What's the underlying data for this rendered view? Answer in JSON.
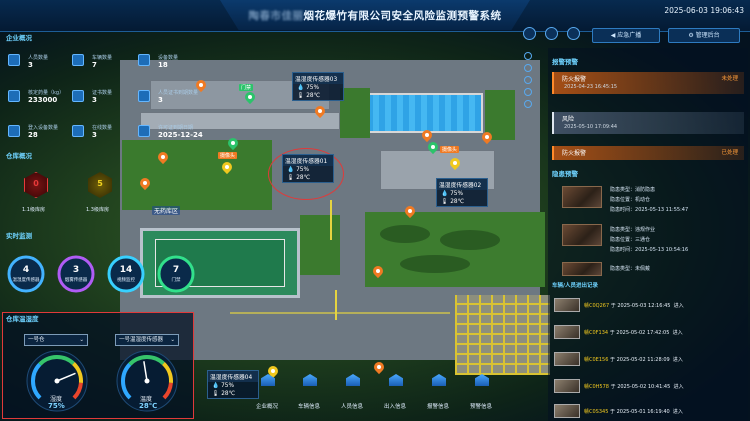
{
  "header": {
    "title_blurred": "陶春市佳丽",
    "title_main": "烟花爆竹有限公司安全风险监测预警系统",
    "datetime": "2025-06-03 19:06:43",
    "btn_broadcast": "应急广播",
    "btn_manage": "管理后台"
  },
  "enterprise": {
    "section_title": "企业概况",
    "stats": [
      {
        "label": "人员数量",
        "value": "3"
      },
      {
        "label": "车辆数量",
        "value": "7"
      },
      {
        "label": "设备数量",
        "value": "18"
      },
      {
        "label": "核定药量（kg）",
        "value": "233000"
      },
      {
        "label": "证书数量",
        "value": "3"
      },
      {
        "label": "人员证书到期数量",
        "value": "3"
      },
      {
        "label": "登入设备数量",
        "value": "28"
      },
      {
        "label": "在线数量",
        "value": "3"
      },
      {
        "label": "许可证到期日期",
        "value": "2025-12-24"
      }
    ]
  },
  "warehouse": {
    "section_title": "仓库概况",
    "items": [
      {
        "value": "0",
        "label": "1.1级库房",
        "color": "#e83a3a"
      },
      {
        "value": "5",
        "label": "1.3级库房",
        "color": "#f0d21f"
      }
    ]
  },
  "monitoring": {
    "section_title": "实时监测",
    "rings": [
      {
        "value": "4",
        "label": "温湿度传感器",
        "color": "#43b3ff"
      },
      {
        "value": "3",
        "label": "烟雾传感器",
        "color": "#b05cf5"
      },
      {
        "value": "14",
        "label": "视频监控",
        "color": "#38d0ff"
      },
      {
        "value": "7",
        "label": "门禁",
        "color": "#32e08b"
      }
    ]
  },
  "temp_humidity": {
    "section_title": "仓库温湿度",
    "select_1": "一号仓",
    "select_2": "一号温湿度传感器",
    "humidity_label": "湿度",
    "humidity_value": "75%",
    "humidity_level": 75,
    "temp_label": "温度",
    "temp_value": "28℃",
    "temp_level": 28
  },
  "map": {
    "zone_label": "无药库区",
    "sensors": [
      {
        "name": "温湿度传感器03",
        "humidity": "75%",
        "temp": "28℃"
      },
      {
        "name": "温湿度传感器01",
        "humidity": "75%",
        "temp": "28℃"
      },
      {
        "name": "温湿度传感器02",
        "humidity": "75%",
        "temp": "28℃"
      },
      {
        "name": "温湿度传感器04",
        "humidity": "75%",
        "temp": "28℃"
      }
    ],
    "tags": [
      "摄像头",
      "门禁",
      "摄像头"
    ]
  },
  "dock": [
    {
      "label": "企业概况"
    },
    {
      "label": "车辆信息"
    },
    {
      "label": "人员信息"
    },
    {
      "label": "出入信息"
    },
    {
      "label": "报警信息"
    },
    {
      "label": "预警信息"
    }
  ],
  "alerts": {
    "section_title": "报警预警",
    "items": [
      {
        "name": "防火报警",
        "status": "未处理",
        "date": "2025-04-23 16:45:15",
        "style": "o"
      },
      {
        "name": "风险",
        "status": "",
        "date": "2025-05-10 17:09:44",
        "style": "w"
      },
      {
        "name": "防火报警",
        "status": "已处理",
        "date": "",
        "style": "o"
      }
    ]
  },
  "risk": {
    "section_title": "隐患预警",
    "items": [
      {
        "type_label": "隐患类型：",
        "type": "消防隐患",
        "loc_label": "隐患位置：",
        "loc": "机动仓",
        "time_label": "隐患时间：",
        "time": "2025-05-13 11:55:47"
      },
      {
        "type_label": "隐患类型：",
        "type": "违规作业",
        "loc_label": "隐患位置：",
        "loc": "三通仓",
        "time_label": "隐患时间：",
        "time": "2025-05-13 10:54:16"
      },
      {
        "type_label": "隐患类型：",
        "type": "未佩戴",
        "loc_label": "",
        "loc": "",
        "time_label": "",
        "time": ""
      }
    ]
  },
  "vehicles": {
    "section_title": "车辆/人员进出记录",
    "rows": [
      {
        "plate": "赣C0Q267",
        "sep": "于",
        "time": "2025-05-03 12:16:45",
        "action": "进入"
      },
      {
        "plate": "赣C0F134",
        "sep": "于",
        "time": "2025-05-02 17:42:05",
        "action": "进入"
      },
      {
        "plate": "赣C0E156",
        "sep": "于",
        "time": "2025-05-02 11:28:09",
        "action": "进入"
      },
      {
        "plate": "赣C0H578",
        "sep": "于",
        "time": "2025-05-02 10:41:45",
        "action": "进入"
      },
      {
        "plate": "赣C0S345",
        "sep": "于",
        "time": "2025-05-01 16:19:40",
        "action": "进入"
      }
    ]
  }
}
